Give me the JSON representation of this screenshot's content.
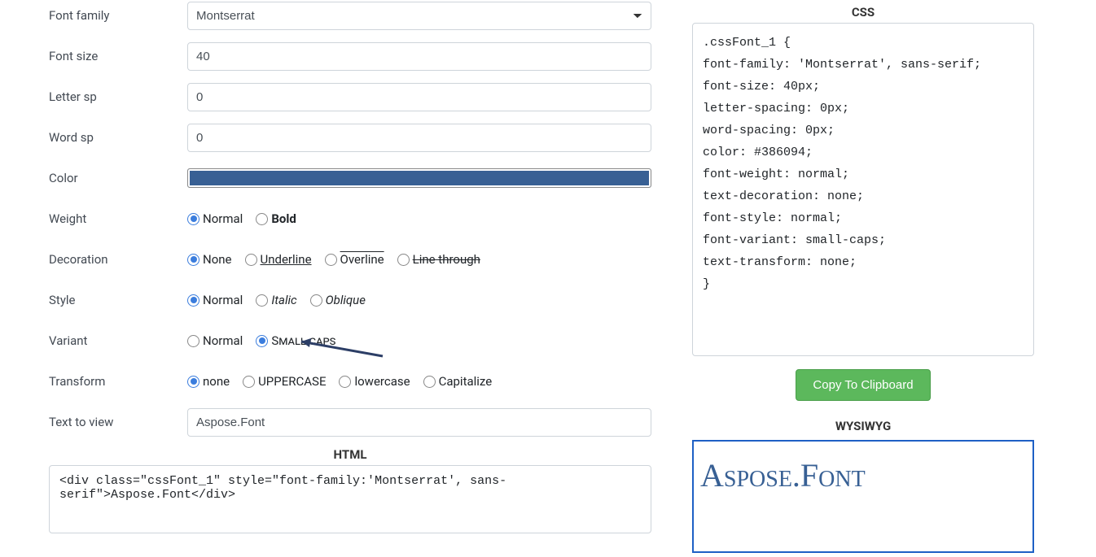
{
  "labels": {
    "font_family": "Font family",
    "font_size": "Font size",
    "letter_sp": "Letter sp",
    "word_sp": "Word sp",
    "color": "Color",
    "weight": "Weight",
    "decoration": "Decoration",
    "style": "Style",
    "variant": "Variant",
    "transform": "Transform",
    "text_to_view": "Text to view"
  },
  "values": {
    "font_family": "Montserrat",
    "font_size": "40",
    "letter_sp": "0",
    "word_sp": "0",
    "color_hex": "#386094",
    "text_to_view": "Aspose.Font"
  },
  "options": {
    "weight": {
      "normal": "Normal",
      "bold": "Bold"
    },
    "decoration": {
      "none": "None",
      "underline": "Underline",
      "overline": "Overline",
      "linethrough": "Line through"
    },
    "style": {
      "normal": "Normal",
      "italic": "Italic",
      "oblique": "Oblique"
    },
    "variant": {
      "normal": "Normal",
      "smallcaps": "Small caps"
    },
    "transform": {
      "none": "none",
      "uppercase": "UPPERCASE",
      "lowercase": "lowercase",
      "capitalize": "Capitalize"
    }
  },
  "selected": {
    "weight": "normal",
    "decoration": "none",
    "style": "normal",
    "variant": "smallcaps",
    "transform": "none"
  },
  "headings": {
    "html": "HTML",
    "css": "CSS",
    "wysiwyg": "WYSIWYG"
  },
  "html_code": "<div class=\"cssFont_1\" style=\"font-family:'Montserrat', sans-serif\">Aspose.Font</div>",
  "css_code": ".cssFont_1 {\nfont-family: 'Montserrat', sans-serif;\nfont-size: 40px;\nletter-spacing: 0px;\nword-spacing: 0px;\ncolor: #386094;\nfont-weight: normal;\ntext-decoration: none;\nfont-style: normal;\nfont-variant: small-caps;\ntext-transform: none;\n}",
  "copy_button": "Copy To Clipboard",
  "preview_text": "Aspose.Font"
}
